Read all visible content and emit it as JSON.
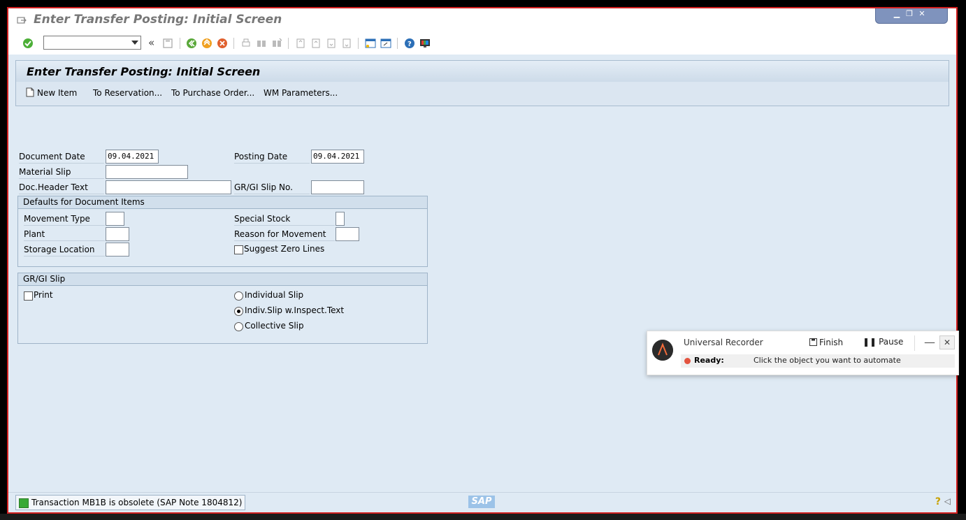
{
  "window": {
    "title": "Enter Transfer Posting: Initial Screen",
    "controls": [
      "minimize",
      "restore",
      "close"
    ]
  },
  "toolbar": {
    "command_field_value": "",
    "back_glyph": "«",
    "icons": [
      "enter-icon",
      "save-icon",
      "back-icon",
      "exit-icon",
      "cancel-icon",
      "print-icon",
      "find-icon",
      "find-next-icon",
      "first-page-icon",
      "previous-page-icon",
      "next-page-icon",
      "last-page-icon",
      "create-session-icon",
      "shortcut-icon",
      "help-icon",
      "customize-layout-icon"
    ]
  },
  "header": {
    "title": "Enter Transfer Posting: Initial Screen",
    "actions": {
      "new_item": "New Item",
      "to_reservation": "To Reservation...",
      "to_purchase_order": "To Purchase Order...",
      "wm_parameters": "WM Parameters..."
    }
  },
  "form": {
    "document_date": {
      "label": "Document Date",
      "value": "09.04.2021"
    },
    "posting_date": {
      "label": "Posting Date",
      "value": "09.04.2021"
    },
    "material_slip": {
      "label": "Material Slip",
      "value": ""
    },
    "doc_header_text": {
      "label": "Doc.Header Text",
      "value": ""
    },
    "gr_gi_slip_no": {
      "label": "GR/GI Slip No.",
      "value": ""
    }
  },
  "defaults_group": {
    "title": "Defaults for Document Items",
    "movement_type": {
      "label": "Movement Type",
      "value": ""
    },
    "plant": {
      "label": "Plant",
      "value": ""
    },
    "storage_location": {
      "label": "Storage Location",
      "value": ""
    },
    "special_stock": {
      "label": "Special Stock",
      "value": ""
    },
    "reason_for_movement": {
      "label": "Reason for Movement",
      "value": ""
    },
    "suggest_zero_lines": {
      "label": "Suggest Zero Lines",
      "checked": false
    }
  },
  "slip_group": {
    "title": "GR/GI Slip",
    "print": {
      "label": "Print",
      "checked": false
    },
    "options": {
      "individual": "Individual Slip",
      "individual_inspect": "Indiv.Slip w.Inspect.Text",
      "collective": "Collective Slip"
    },
    "selected": "individual_inspect"
  },
  "status": {
    "message": "Transaction MB1B is obsolete (SAP Note 1804812)",
    "type": "success",
    "logo": "SAP"
  },
  "recorder": {
    "title": "Universal Recorder",
    "finish": "Finish",
    "pause": "Pause",
    "state": "Ready:",
    "message": "Click the object you want to automate",
    "minimize": "—",
    "close": "✕"
  },
  "colors": {
    "frame_border": "#d21f1f",
    "content_bg": "#dfeaf4",
    "accent_green": "#39a935",
    "recorder_dot": "#e3533f"
  }
}
